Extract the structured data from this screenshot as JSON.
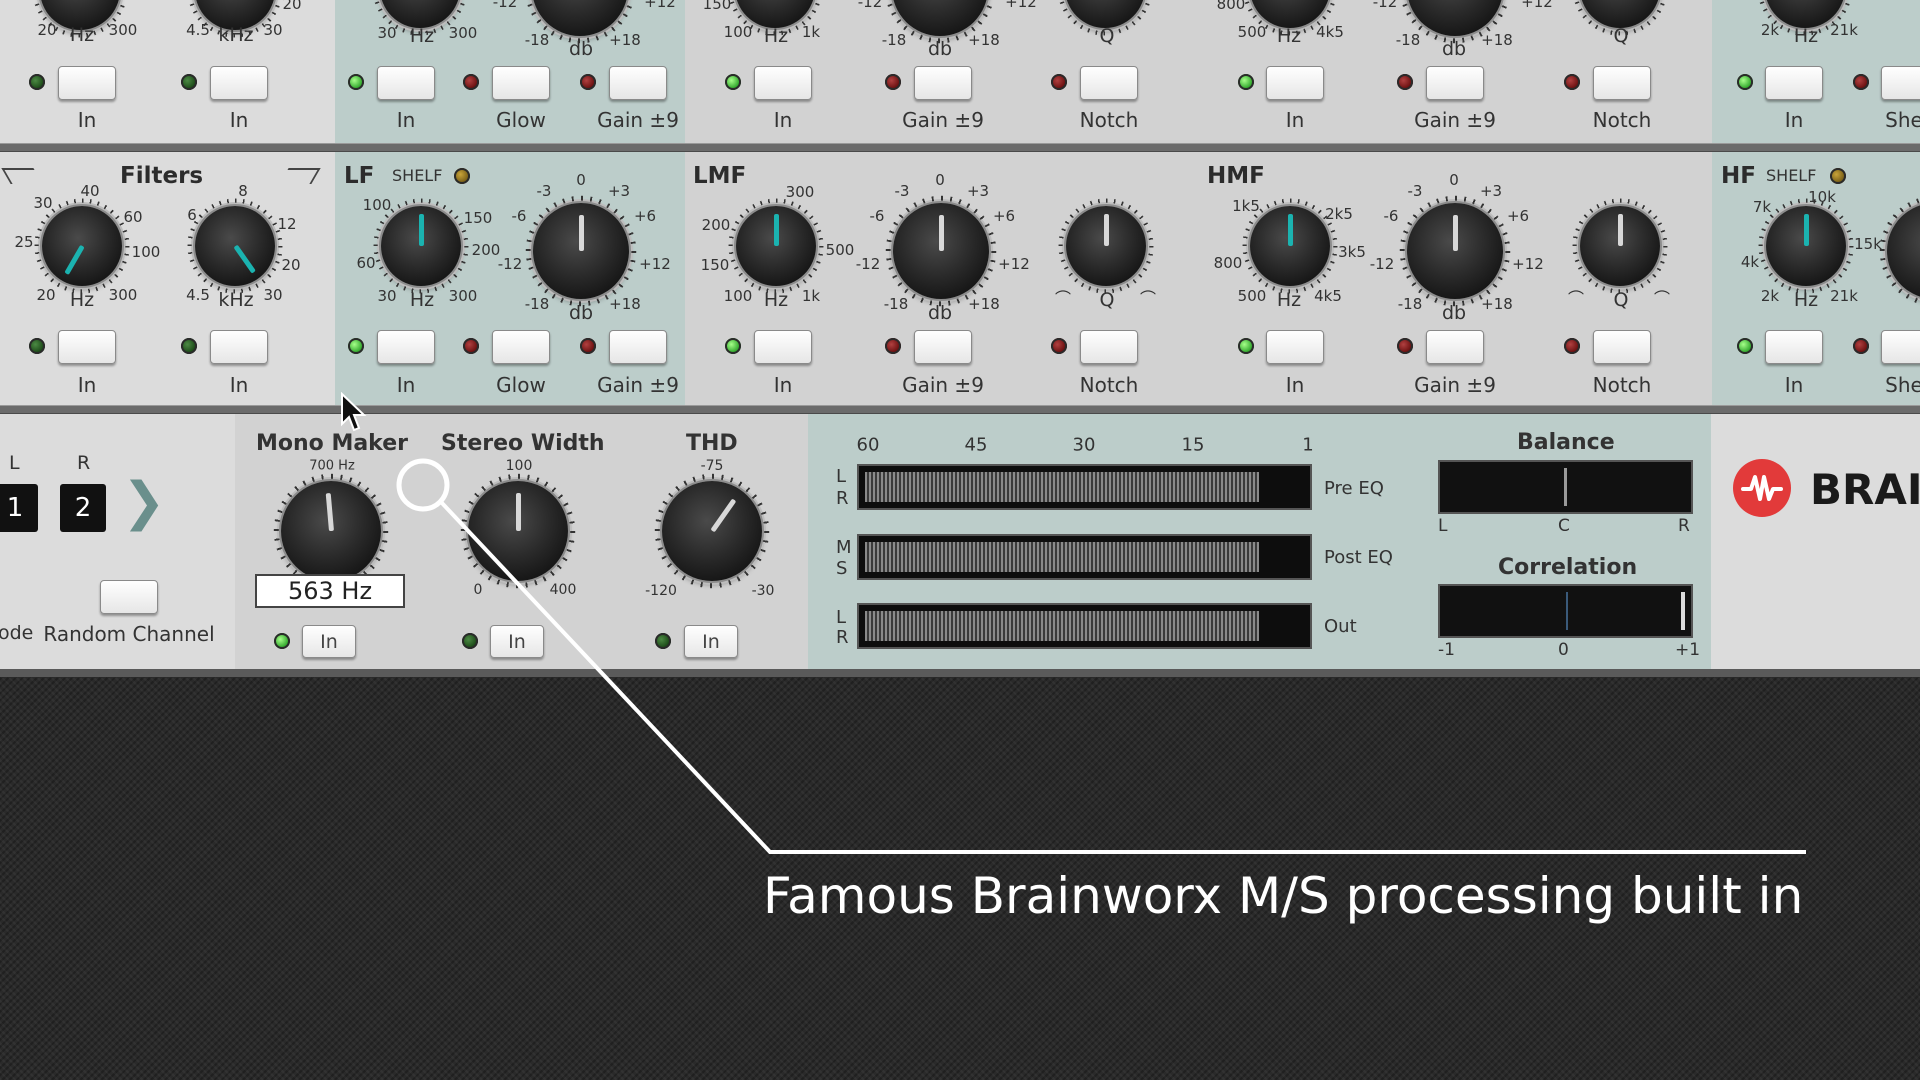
{
  "top_strip": {
    "left_ticks": [
      "20",
      "Hz",
      "300",
      "4.5",
      "kHz",
      "30",
      "20"
    ],
    "lf_ticks": [
      "30",
      "Hz",
      "300",
      "-18",
      "db",
      "+18",
      "-12",
      "+12"
    ],
    "lmf_ticks": [
      "100",
      "Hz",
      "1k",
      "-18",
      "db",
      "+18",
      "Q",
      "150",
      "+12",
      "-12"
    ],
    "hmf_ticks": [
      "500",
      "Hz",
      "4k5",
      "-18",
      "db",
      "+18",
      "Q",
      "800",
      "+12",
      "-12"
    ],
    "hf_ticks": [
      "2k",
      "Hz",
      "21k"
    ],
    "labels": [
      "In",
      "In",
      "In",
      "Glow",
      "Gain ±9",
      "In",
      "Gain ±9",
      "Notch",
      "In",
      "Gain ±9",
      "Notch",
      "In",
      "She"
    ]
  },
  "filters": {
    "title": "Filters",
    "hp_ticks": [
      "30",
      "40",
      "60",
      "25",
      "100",
      "20",
      "Hz",
      "300"
    ],
    "lp_ticks": [
      "6",
      "8",
      "12",
      "20",
      "4.5",
      "kHz",
      "30"
    ],
    "in1": "In",
    "in2": "In"
  },
  "lf": {
    "title": "LF",
    "shelf": "SHELF",
    "freq_ticks": [
      "100",
      "150",
      "60",
      "200",
      "30",
      "Hz",
      "300"
    ],
    "gain_ticks": [
      "-3",
      "0",
      "+3",
      "-6",
      "+6",
      "-12",
      "+12",
      "-18",
      "db",
      "+18"
    ],
    "in": "In",
    "glow": "Glow",
    "gain9": "Gain ±9"
  },
  "lmf": {
    "title": "LMF",
    "freq_ticks": [
      "300",
      "200",
      "150",
      "500",
      "100",
      "Hz",
      "1k"
    ],
    "gain_ticks": [
      "-3",
      "0",
      "+3",
      "-6",
      "+6",
      "-12",
      "+12",
      "-18",
      "db",
      "+18"
    ],
    "q_label": "Q",
    "in": "In",
    "gain9": "Gain ±9",
    "notch": "Notch"
  },
  "hmf": {
    "title": "HMF",
    "freq_ticks": [
      "1k5",
      "2k5",
      "3k5",
      "800",
      "500",
      "Hz",
      "4k5"
    ],
    "gain_ticks": [
      "-3",
      "0",
      "+3",
      "-6",
      "+6",
      "-12",
      "+12",
      "-18",
      "db",
      "+18"
    ],
    "q_label": "Q",
    "in": "In",
    "gain9": "Gain ±9",
    "notch": "Notch"
  },
  "hf": {
    "title": "HF",
    "shelf": "SHELF",
    "freq_ticks": [
      "10k",
      "7k",
      "15k",
      "4k",
      "2k",
      "Hz",
      "21k"
    ],
    "in": "In",
    "shelf_btn": "She"
  },
  "channel": {
    "l": "L",
    "r": "R",
    "ch1": "1",
    "ch2": "2",
    "mode_partial": "ode",
    "random_channel": "Random Channel"
  },
  "mono_maker": {
    "title": "Mono Maker",
    "top_tick": "700 Hz",
    "value": "563 Hz",
    "in": "In"
  },
  "stereo_width": {
    "title": "Stereo Width",
    "top_tick": "100",
    "min": "0",
    "max": "400",
    "in": "In"
  },
  "thd": {
    "title": "THD",
    "top_tick": "-75",
    "min": "-120",
    "max": "-30",
    "in": "In"
  },
  "meters": {
    "scale": [
      "60",
      "45",
      "30",
      "15",
      "1"
    ],
    "rows": [
      {
        "ch_top": "L",
        "ch_bottom": "R",
        "label": "Pre EQ",
        "level": 0.9
      },
      {
        "ch_top": "M",
        "ch_bottom": "S",
        "label": "Post EQ",
        "level": 0.9
      },
      {
        "ch_top": "L",
        "ch_bottom": "R",
        "label": "Out",
        "level": 0.9
      }
    ]
  },
  "balance": {
    "title": "Balance",
    "left": "L",
    "center": "C",
    "right": "R",
    "value": 0.5
  },
  "correlation": {
    "title": "Correlation",
    "min": "-1",
    "mid": "0",
    "max": "+1",
    "value": 1.0
  },
  "brand": {
    "name_partial": "BRAIN"
  },
  "caption": {
    "text": "Famous Brainworx M/S processing built in"
  },
  "colors": {
    "accent_teal": "#1bb3b0",
    "led_green": "#2ea52a",
    "led_red": "#6a1010",
    "brand_red": "#e23a3a"
  }
}
